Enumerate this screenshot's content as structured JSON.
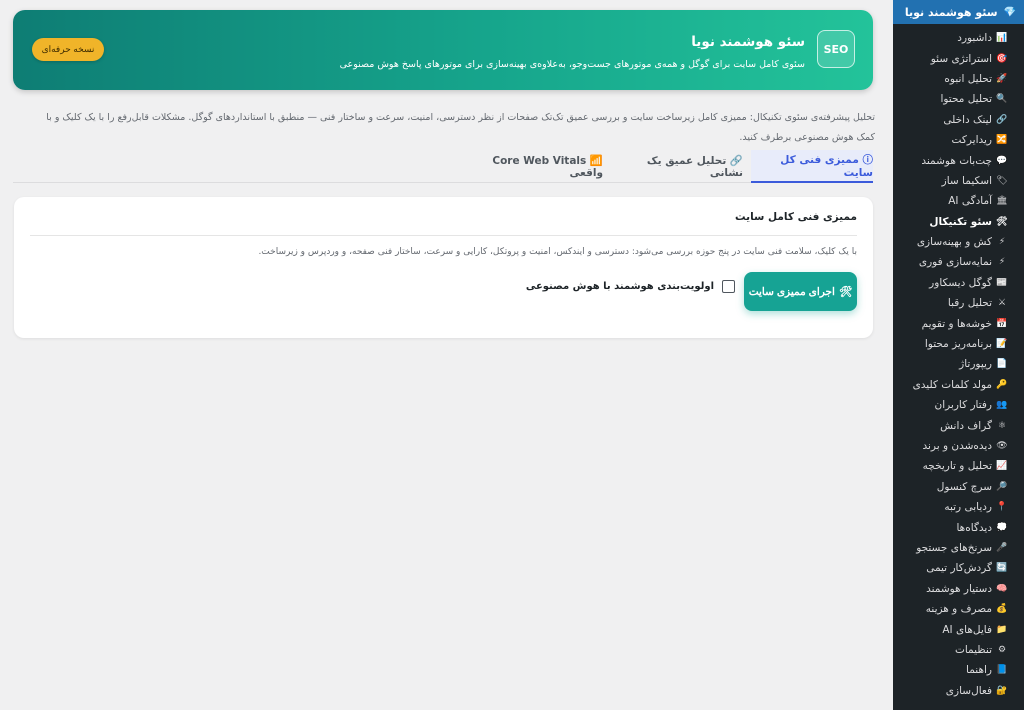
{
  "sidebar": {
    "header": "سئو هوشمند نویا",
    "items": [
      {
        "icon": "📊",
        "label": "داشبورد"
      },
      {
        "icon": "🎯",
        "label": "استراتژی سئو"
      },
      {
        "icon": "🚀",
        "label": "تحلیل انبوه"
      },
      {
        "icon": "🔍",
        "label": "تحلیل محتوا"
      },
      {
        "icon": "🔗",
        "label": "لینک داخلی"
      },
      {
        "icon": "🔀",
        "label": "ریدایرکت"
      },
      {
        "icon": "💬",
        "label": "چت‌بات هوشمند"
      },
      {
        "icon": "🏷",
        "label": "اسکیما ساز"
      },
      {
        "icon": "🏛",
        "label": "آمادگی AI"
      },
      {
        "icon": "🛠",
        "label": "سئو تکنیکال"
      },
      {
        "icon": "⚡",
        "label": "کش و بهینه‌سازی"
      },
      {
        "icon": "⚡",
        "label": "نمایه‌سازی فوری"
      },
      {
        "icon": "📰",
        "label": "گوگل دیسکاور"
      },
      {
        "icon": "⚔",
        "label": "تحلیل رقبا"
      },
      {
        "icon": "📅",
        "label": "خوشه‌ها و تقویم"
      },
      {
        "icon": "📝",
        "label": "برنامه‌ریز محتوا"
      },
      {
        "icon": "📄",
        "label": "ریپورتاژ"
      },
      {
        "icon": "🔑",
        "label": "مولد کلمات کلیدی"
      },
      {
        "icon": "👥",
        "label": "رفتار کاربران"
      },
      {
        "icon": "⚛",
        "label": "گراف دانش"
      },
      {
        "icon": "👁",
        "label": "دیده‌شدن و برند"
      },
      {
        "icon": "📈",
        "label": "تحلیل و تاریخچه"
      },
      {
        "icon": "🔎",
        "label": "سرچ کنسول"
      },
      {
        "icon": "📍",
        "label": "ردیابی رتبه"
      },
      {
        "icon": "💭",
        "label": "دیدگاه‌ها"
      },
      {
        "icon": "🎤",
        "label": "سرنخ‌های جستجو"
      },
      {
        "icon": "🔄",
        "label": "گردش‌کار تیمی"
      },
      {
        "icon": "🧠",
        "label": "دستیار هوشمند"
      },
      {
        "icon": "💰",
        "label": "مصرف و هزینه"
      },
      {
        "icon": "📁",
        "label": "فایل‌های AI"
      },
      {
        "icon": "⚙",
        "label": "تنظیمات"
      },
      {
        "icon": "📘",
        "label": "راهنما"
      },
      {
        "icon": "🔐",
        "label": "فعال‌سازی"
      }
    ]
  },
  "hero": {
    "badge": "SEO",
    "title": "سئو هوشمند نویا",
    "subtitle": "سئوی کامل سایت برای گوگل و همه‌ی موتورهای جست‌وجو، به‌علاوه‌ی بهینه‌سازی برای موتورهای پاسخ هوش مصنوعی",
    "pro_button": "نسخه حرفه‌ای"
  },
  "intro": "تحلیل پیشرفته‌ی سئوی تکنیکال: ممیزی کامل زیرساخت سایت و بررسی عمیق تک‌تک صفحات از نظر دسترسی، امنیت، سرعت و ساختار فنی — منطبق با استانداردهای گوگل. مشکلات قابل‌رفع را با یک کلیک و با کمک هوش مصنوعی برطرف کنید.",
  "tabs": [
    "ⓘ ممیزی فنی کل سایت",
    "🔗 تحلیل عمیق یک نشانی",
    "📶 Core Web Vitals واقعی"
  ],
  "card": {
    "title": "ممیزی فنی کامل سایت",
    "description": "با یک کلیک، سلامت فنی سایت در پنج حوزه بررسی می‌شود: دسترسی و ایندکس، امنیت و پروتکل، کارایی و سرعت، ساختار فنی صفحه، و وردپرس و زیرساخت.",
    "run_button": "اجرای ممیزی سایت",
    "run_icon": "🛠",
    "checkbox_label": "اولویت‌بندی هوشمند با هوش مصنوعی",
    "checkbox_checked": false
  }
}
